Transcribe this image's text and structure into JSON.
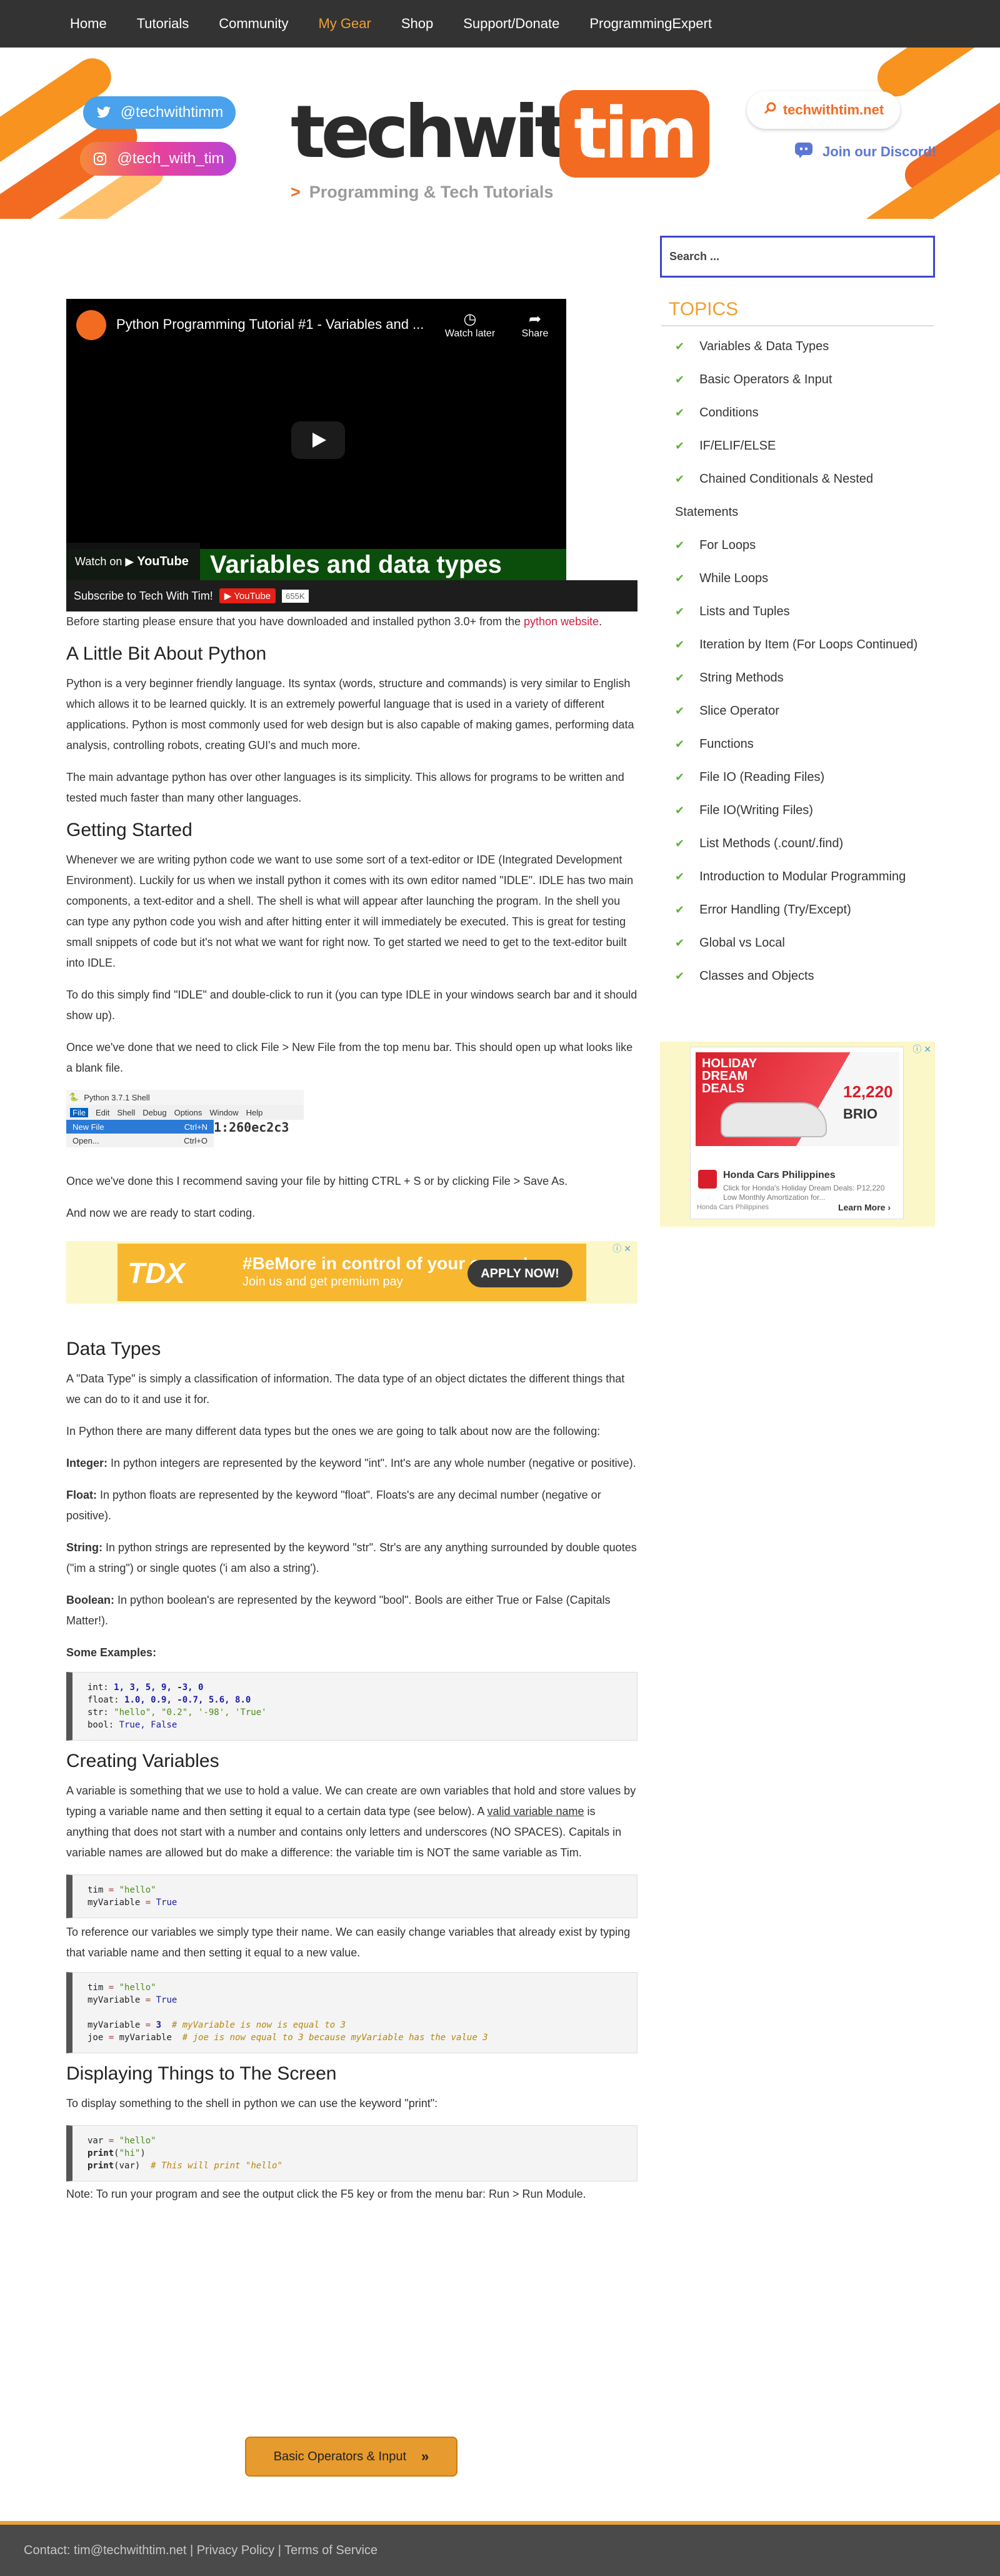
{
  "nav": {
    "items": [
      "Home",
      "Tutorials",
      "Community",
      "My Gear",
      "Shop",
      "Support/Donate",
      "ProgrammingExpert"
    ],
    "active_index": 3
  },
  "hero": {
    "twitter": "@techwithtimm",
    "instagram": "@tech_with_tim",
    "logo_tech": "techwith",
    "logo_tim": "tim",
    "subtitle": "Programming & Tech Tutorials",
    "site": "techwithtim.net",
    "discord": "Join our Discord!"
  },
  "video": {
    "title": "Python Programming Tutorial #1 - Variables and ...",
    "watch_later": "Watch later",
    "share": "Share",
    "band_text": "Variables and data types",
    "watch_on": "Watch on",
    "youtube": "YouTube",
    "subscribe": "Subscribe to Tech With Tim!",
    "yt_badge": "YouTube",
    "sub_count": "655K"
  },
  "content": {
    "intro_pre": "Before starting please ensure that you have downloaded and installed python 3.0+ from the",
    "intro_link": "python website",
    "intro_post": ".",
    "h_about": "A Little Bit About Python",
    "p_about1": "Python is a very beginner friendly language. Its syntax (words, structure and commands) is very similar to English which allows it to be learned quickly. It is an extremely powerful language that is used in a variety of different applications. Python is most commonly used for web design but is also capable of making games, performing data analysis, controlling robots, creating GUI's and much more.",
    "p_about2": "The main advantage python has over other languages is its simplicity. This allows for programs to be written and tested much faster than many other languages.",
    "h_start": "Getting Started",
    "p_start1": "Whenever we are writing python code we want to use some sort of a text-editor or IDE (Integrated Development Environment). Luckily for us when we install python it comes with its own editor named \"IDLE\". IDLE has two main components, a text-editor and a shell. The shell is what will appear after launching the program. In the shell you can type any python code you wish and after hitting enter it will immediately be executed. This is great for testing small snippets of code but it's not what we want for right now. To get started we need to get to the text-editor built into IDLE.",
    "p_start2": "To do this simply find \"IDLE\" and double-click to run it (you can type IDLE in your windows search bar and it should show up).",
    "p_start3": "Once we've done that we need to click File > New File  from the top menu bar. This should open up what looks like a blank file.",
    "p_start4": "Once we've done this I recommend saving your file by hitting CTRL + S or by clicking File >  Save As.",
    "p_start5": "And now we are ready to start coding.",
    "h_types": "Data Types",
    "p_types1": "A \"Data Type\" is simply a classification of information. The data type of an object dictates the different things that we can do to it and use it for.",
    "p_types2": "In Python there are many different data types but the ones we are going to talk about now are the following:",
    "t_int_b": "Integer:",
    "t_int": " In python integers are represented by the keyword \"int\". Int's are any whole number (negative or positive).",
    "t_float_b": "Float:",
    "t_float": " In python floats are represented by the keyword \"float\". Floats's are any decimal number (negative or positive).",
    "t_str_b": "String:",
    "t_str": " In python strings are represented by the keyword \"str\". Str's are any anything surrounded by double quotes (\"im a string\") or single quotes ('i am also a string').",
    "t_bool_b": "Boolean:",
    "t_bool": " In python boolean's are represented by the keyword \"bool\". Bools are either True or False (Capitals Matter!).",
    "t_examples": "Some Examples:",
    "h_vars": "Creating Variables",
    "p_vars1a": "A variable is something that we use to hold a value. We can create are own variables that hold and store values by typing a variable name and then setting it equal to a certain data type (see below). A ",
    "p_vars1_link": "valid variable name",
    "p_vars1b": " is anything that does not start with a number and contains only letters and underscores (NO SPACES). Capitals in variable names are allowed but do make a difference: the variable tim is NOT the same variable as Tim.",
    "p_vars2": "To reference our variables we simply type their name. We can easily change variables that already exist by typing that variable name and then setting it equal to a new value.",
    "h_display": "Displaying Things to The Screen",
    "p_display1": "To display something to the shell in python we can use the keyword \"print\":",
    "p_display2": "Note: To run your program and see the output click the F5 key or from the menu bar: Run > Run Module.",
    "next_button": "Basic Operators & Input"
  },
  "idle": {
    "title": "Python 3.7.1 Shell",
    "menu": [
      "File",
      "Edit",
      "Shell",
      "Debug",
      "Options",
      "Window",
      "Help"
    ],
    "items": [
      {
        "label": "New File",
        "key": "Ctrl+N"
      },
      {
        "label": "Open...",
        "key": "Ctrl+O"
      }
    ],
    "shell_text": "1:260ec2c3"
  },
  "ad": {
    "logo": "TDX",
    "headline": "#BeMore in control of your career!",
    "sub": "Join us and get premium pay",
    "cta": "APPLY NOW!"
  },
  "side_ad": {
    "headline": "HOLIDAY DREAM DEALS",
    "price": "12,220",
    "model": "BRIO",
    "brand": "Honda Cars Philippines",
    "text": "Click for Honda's Holiday Dream Deals: P12,220 Low Monthly Amortization for...",
    "source": "Honda Cars Philippines",
    "cta": "Learn More"
  },
  "sidebar": {
    "search_placeholder": "Search ...",
    "topics_heading": "TOPICS",
    "topics": [
      "Variables & Data Types",
      "Basic Operators & Input",
      "Conditions",
      "IF/ELIF/ELSE",
      "Chained Conditionals & Nested Statements",
      "For Loops",
      "While Loops",
      "Lists and Tuples",
      "Iteration by Item (For Loops Continued)",
      "String Methods",
      "Slice Operator",
      "Functions",
      "File IO (Reading Files)",
      "File IO(Writing Files)",
      "List Methods (.count/.find)",
      "Introduction to Modular Programming",
      "Error Handling (Try/Except)",
      "Global vs Local",
      "Classes and Objects"
    ]
  },
  "footer": {
    "text": "Contact: tim@techwithtim.net | Privacy Policy | Terms of Service"
  },
  "colors": {
    "accent": "#f0a030",
    "brand_orange": "#f26b21",
    "link_red": "#d11c3c",
    "check_green": "#5cb335",
    "search_border": "#3d45c8"
  }
}
